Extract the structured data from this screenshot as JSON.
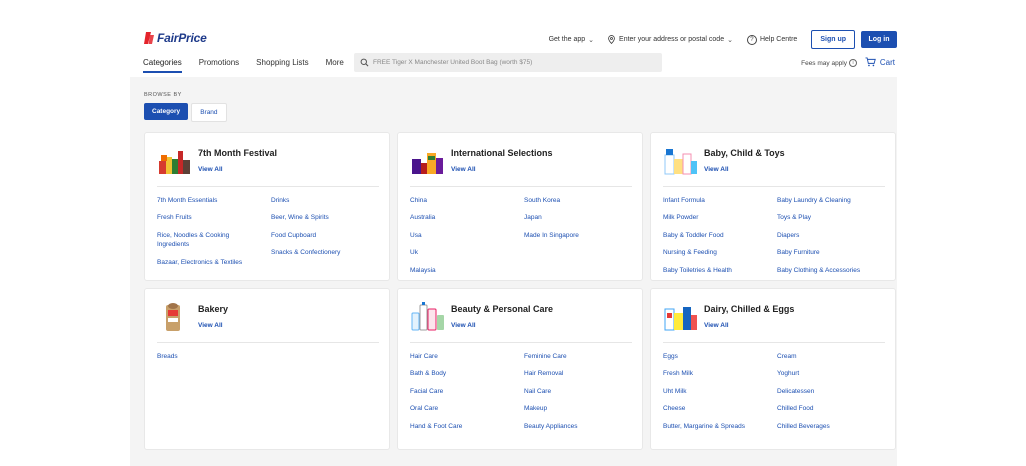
{
  "brand": {
    "logo_text": "FairPrice"
  },
  "topbar": {
    "get_app": "Get the app",
    "address": "Enter your address or postal code",
    "help": "Help Centre",
    "signup": "Sign up",
    "login": "Log in"
  },
  "nav": {
    "items": [
      "Categories",
      "Promotions",
      "Shopping Lists",
      "More"
    ]
  },
  "search": {
    "placeholder": "FREE Tiger X Manchester United Boot Bag (worth $75)"
  },
  "fees": "Fees may apply",
  "cart": "Cart",
  "browse": {
    "label": "BROWSE BY",
    "category": "Category",
    "brand": "Brand"
  },
  "view_all": "View All",
  "colors": {
    "accent": "#1c4fb1",
    "brand_red": "#e4232b",
    "brand_navy": "#1e3a8a",
    "content_bg": "#f4f4f4"
  },
  "cards": [
    {
      "title": "7th Month Festival",
      "items": [
        "7th Month Essentials",
        "Drinks",
        "Fresh Fruits",
        "Beer, Wine & Spirits",
        "Rice, Noodles & Cooking Ingredients",
        "Food Cupboard",
        "Bazaar, Electronics & Textiles",
        "Snacks & Confectionery"
      ]
    },
    {
      "title": "International Selections",
      "items": [
        "China",
        "South Korea",
        "Australia",
        "Japan",
        "Usa",
        "Made In Singapore",
        "Uk",
        "Malaysia"
      ]
    },
    {
      "title": "Baby, Child & Toys",
      "items": [
        "Infant Formula",
        "Baby Laundry & Cleaning",
        "Milk Powder",
        "Toys & Play",
        "Baby & Toddler Food",
        "Diapers",
        "Nursing & Feeding",
        "Baby Furniture",
        "Baby Toiletries & Health",
        "Baby Clothing & Accessories"
      ]
    },
    {
      "title": "Bakery",
      "items": [
        "Breads"
      ]
    },
    {
      "title": "Beauty & Personal Care",
      "items": [
        "Hair Care",
        "Feminine Care",
        "Bath & Body",
        "Hair Removal",
        "Facial Care",
        "Nail Care",
        "Oral Care",
        "Makeup",
        "Hand & Foot Care",
        "Beauty Appliances"
      ]
    },
    {
      "title": "Dairy, Chilled & Eggs",
      "items": [
        "Eggs",
        "Cream",
        "Fresh Milk",
        "Yoghurt",
        "Uht Milk",
        "Delicatessen",
        "Cheese",
        "Chilled Food",
        "Butter, Margarine & Spreads",
        "Chilled Beverages"
      ]
    }
  ]
}
